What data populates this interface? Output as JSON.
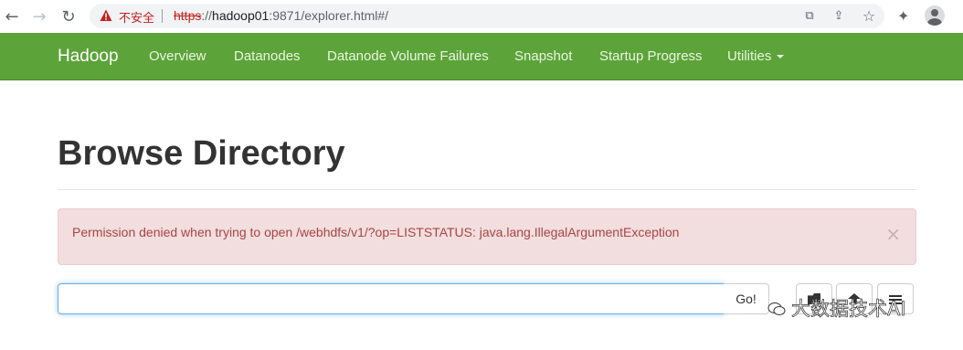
{
  "browser": {
    "security_label": "不安全",
    "url_scheme": "https",
    "url_sep": "://",
    "url_host": "hadoop01",
    "url_rest": ":9871/explorer.html#/",
    "icons": [
      "back-arrow-icon",
      "forward-arrow-icon",
      "reload-icon",
      "warning-icon",
      "translate-icon",
      "share-icon",
      "star-icon",
      "extensions-icon",
      "profile-icon"
    ]
  },
  "navbar": {
    "brand": "Hadoop",
    "links": [
      "Overview",
      "Datanodes",
      "Datanode Volume Failures",
      "Snapshot",
      "Startup Progress",
      "Utilities"
    ],
    "color": "#5ca339"
  },
  "main": {
    "title": "Browse Directory",
    "alert": {
      "message": "Permission denied when trying to open /webhdfs/v1/?op=LISTSTATUS: java.lang.IllegalArgumentException",
      "close": "×",
      "bg_color": "#f2dede",
      "text_color": "#a94442"
    },
    "path_input": {
      "value": "",
      "placeholder": ""
    },
    "go_label": "Go!",
    "tool_icons": [
      "create-folder-icon",
      "upload-icon",
      "cut-icon"
    ]
  },
  "watermark": "大数据技术AI"
}
